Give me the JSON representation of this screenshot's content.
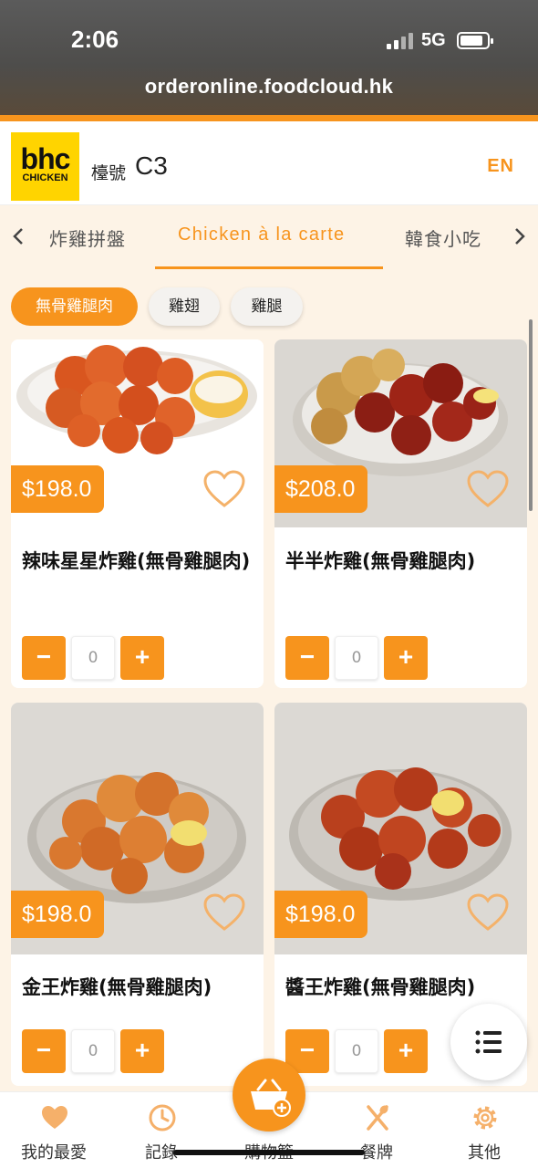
{
  "status": {
    "time": "2:06",
    "network": "5G"
  },
  "browser": {
    "url": "orderonline.foodcloud.hk"
  },
  "header": {
    "logo_main": "bhc",
    "logo_sub": "CHICKEN",
    "table_label": "檯號",
    "table_number": "C3",
    "language": "EN"
  },
  "tabs": [
    {
      "label": "炸雞拼盤"
    },
    {
      "label": "Chicken à la carte",
      "active": true
    },
    {
      "label": "韓食小吃"
    }
  ],
  "chips": [
    {
      "label": "無骨雞腿肉",
      "active": true
    },
    {
      "label": "雞翅"
    },
    {
      "label": "雞腿"
    }
  ],
  "products": [
    {
      "price": "$198.0",
      "name": "辣味星星炸雞(無骨雞腿肉)",
      "qty": "0"
    },
    {
      "price": "$208.0",
      "name": "半半炸雞(無骨雞腿肉)",
      "qty": "0"
    },
    {
      "price": "$198.0",
      "name": "金王炸雞(無骨雞腿肉)",
      "qty": "0"
    },
    {
      "price": "$198.0",
      "name": "醬王炸雞(無骨雞腿肉)",
      "qty": "0"
    }
  ],
  "qty_controls": {
    "minus": "−",
    "plus": "+"
  },
  "nav": [
    {
      "label": "我的最愛",
      "icon": "heart-icon"
    },
    {
      "label": "記錄",
      "icon": "clock-icon"
    },
    {
      "label": "購物籃",
      "icon": "basket-icon"
    },
    {
      "label": "餐牌",
      "icon": "utensils-icon"
    },
    {
      "label": "其他",
      "icon": "gear-icon"
    }
  ],
  "colors": {
    "accent": "#f7941d",
    "background": "#fdf3e6",
    "logo": "#ffd400"
  }
}
